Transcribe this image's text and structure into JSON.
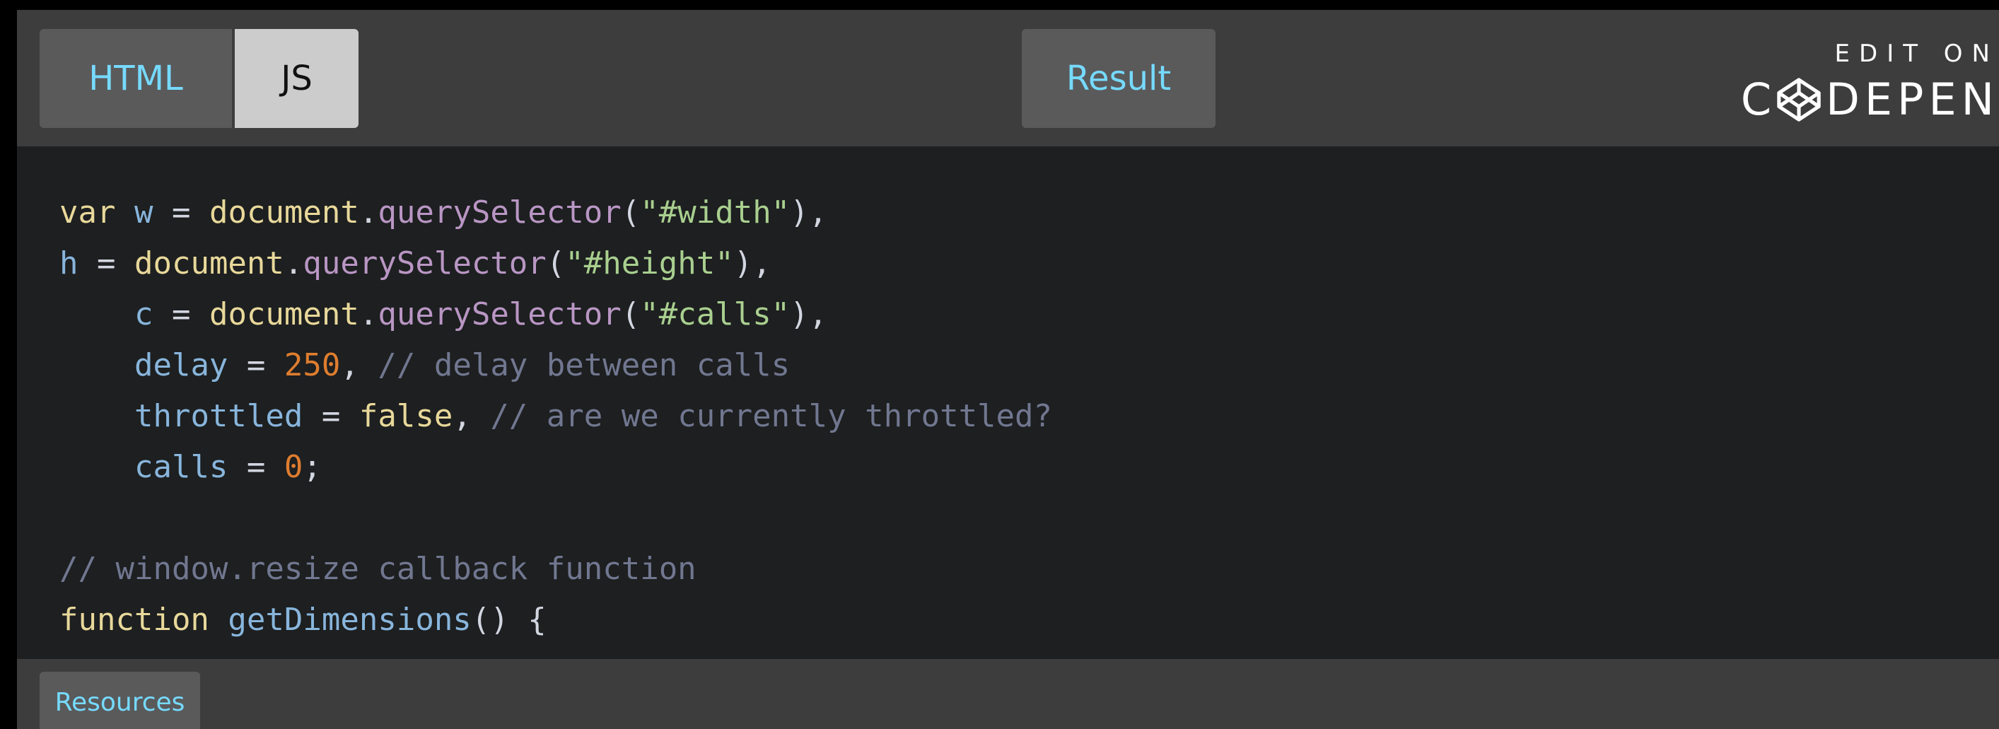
{
  "tabs": {
    "html_label": "HTML",
    "js_label": "JS",
    "result_label": "Result"
  },
  "brand": {
    "edit_label": "EDIT ON",
    "logo_prefix": "C",
    "logo_suffix": "DEPEN"
  },
  "code": {
    "lines": [
      [
        {
          "t": "var",
          "k": "kw"
        },
        {
          "t": " ",
          "k": "plain"
        },
        {
          "t": "w",
          "k": "var"
        },
        {
          "t": " = ",
          "k": "plain"
        },
        {
          "t": "document",
          "k": "obj"
        },
        {
          "t": ".",
          "k": "plain"
        },
        {
          "t": "querySelector",
          "k": "method"
        },
        {
          "t": "(",
          "k": "plain"
        },
        {
          "t": "\"#width\"",
          "k": "string"
        },
        {
          "t": "),",
          "k": "plain"
        }
      ],
      [
        {
          "t": "h",
          "k": "var"
        },
        {
          "t": " = ",
          "k": "plain"
        },
        {
          "t": "document",
          "k": "obj"
        },
        {
          "t": ".",
          "k": "plain"
        },
        {
          "t": "querySelector",
          "k": "method"
        },
        {
          "t": "(",
          "k": "plain"
        },
        {
          "t": "\"#height\"",
          "k": "string"
        },
        {
          "t": "),",
          "k": "plain"
        }
      ],
      [
        {
          "t": "    ",
          "k": "plain"
        },
        {
          "t": "c",
          "k": "var"
        },
        {
          "t": " = ",
          "k": "plain"
        },
        {
          "t": "document",
          "k": "obj"
        },
        {
          "t": ".",
          "k": "plain"
        },
        {
          "t": "querySelector",
          "k": "method"
        },
        {
          "t": "(",
          "k": "plain"
        },
        {
          "t": "\"#calls\"",
          "k": "string"
        },
        {
          "t": "),",
          "k": "plain"
        }
      ],
      [
        {
          "t": "    ",
          "k": "plain"
        },
        {
          "t": "delay",
          "k": "var"
        },
        {
          "t": " = ",
          "k": "plain"
        },
        {
          "t": "250",
          "k": "number"
        },
        {
          "t": ", ",
          "k": "plain"
        },
        {
          "t": "// delay between calls",
          "k": "comment"
        }
      ],
      [
        {
          "t": "    ",
          "k": "plain"
        },
        {
          "t": "throttled",
          "k": "var"
        },
        {
          "t": " = ",
          "k": "plain"
        },
        {
          "t": "false",
          "k": "bool"
        },
        {
          "t": ", ",
          "k": "plain"
        },
        {
          "t": "// are we currently throttled?",
          "k": "comment"
        }
      ],
      [
        {
          "t": "    ",
          "k": "plain"
        },
        {
          "t": "calls",
          "k": "var"
        },
        {
          "t": " = ",
          "k": "plain"
        },
        {
          "t": "0",
          "k": "number"
        },
        {
          "t": ";",
          "k": "plain"
        }
      ],
      [],
      [
        {
          "t": "// window.resize callback function",
          "k": "comment"
        }
      ],
      [
        {
          "t": "function",
          "k": "kw"
        },
        {
          "t": " ",
          "k": "plain"
        },
        {
          "t": "getDimensions",
          "k": "fn"
        },
        {
          "t": "() {",
          "k": "plain"
        }
      ]
    ]
  },
  "bottom": {
    "resources_label": "Resources"
  },
  "colors": {
    "accent": "#76daff",
    "bar_background": "#3d3d3e",
    "code_background": "#1d1f20",
    "tab_background": "#5a5a5b",
    "tab_active_background": "#cccccc"
  },
  "icons": {
    "codepen_logo": "codepen-cube-icon"
  }
}
